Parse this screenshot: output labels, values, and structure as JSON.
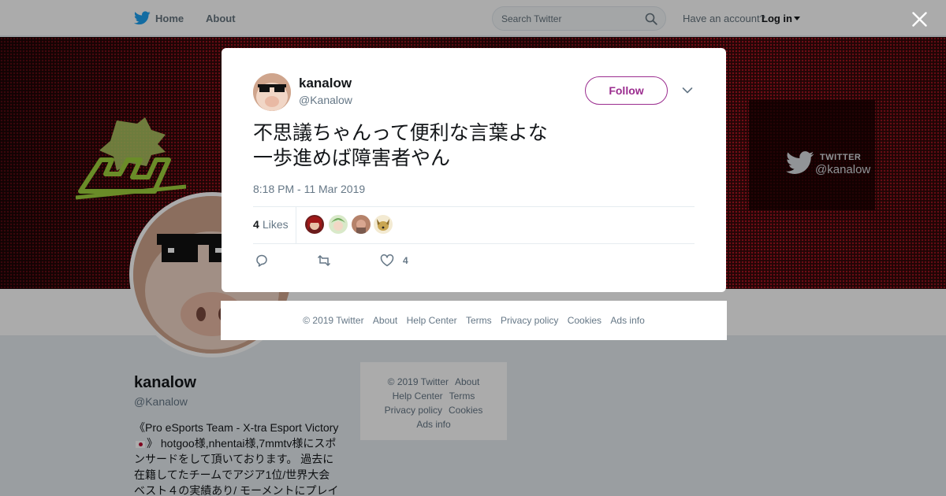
{
  "nav": {
    "home_label": "Home",
    "about_label": "About",
    "search_placeholder": "Search Twitter",
    "account_prompt": "Have an account?",
    "login_label": "Log in"
  },
  "banner": {
    "watermark_label": "TWITTER",
    "watermark_handle": "@kanalow"
  },
  "profile": {
    "name": "kanalow",
    "handle": "@Kanalow",
    "bio_line1": "《Pro eSports Team - X-tra Esport Victory",
    "bio_line2": "》 hotgoo様,nhentai様,7mmtv様にスポ",
    "bio_line3": "ンサードをして頂いております。 過去に",
    "bio_line4": "在籍してたチームでアジア1位/世界大会",
    "bio_line5": "ベスト４の実績あり/ モーメントにプレイ"
  },
  "background_footer": [
    "© 2019 Twitter",
    "About",
    "Help Center",
    "Terms",
    "Privacy policy",
    "Cookies",
    "Ads info"
  ],
  "tweet": {
    "author_name": "kanalow",
    "author_handle": "@Kanalow",
    "follow_label": "Follow",
    "text_line1": "不思議ちゃんって便利な言葉よな",
    "text_line2": "一歩進めば障害者やん",
    "timestamp": "8:18 PM - 11 Mar 2019",
    "likes_count": "4",
    "likes_label": "Likes",
    "action_like_count": "4",
    "likers": [
      {
        "icon": "avatar-red-haired",
        "color": "#6b1c1c"
      },
      {
        "icon": "avatar-green-anime",
        "color": "#8fbf7a"
      },
      {
        "icon": "avatar-illustrated",
        "color": "#b5826a"
      },
      {
        "icon": "avatar-dog",
        "color": "#c9a652"
      }
    ]
  },
  "footer": {
    "items": [
      "© 2019 Twitter",
      "About",
      "Help Center",
      "Terms",
      "Privacy policy",
      "Cookies",
      "Ads info"
    ]
  },
  "colors": {
    "twitter_blue": "#1da1f2",
    "follow_accent": "#9b2d8f",
    "banner_red": "#d4172a"
  }
}
